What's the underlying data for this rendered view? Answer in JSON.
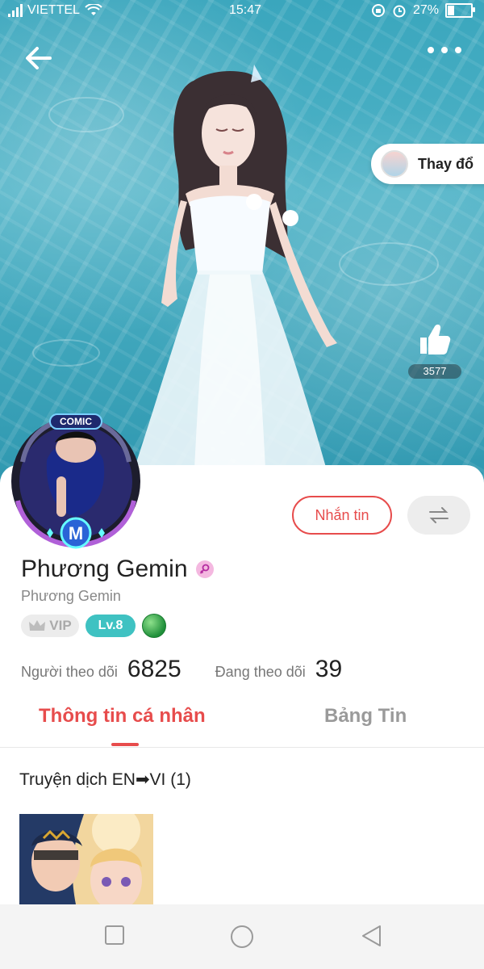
{
  "status_bar": {
    "carrier": "VIETTEL",
    "time": "15:47",
    "battery_percent": "27%"
  },
  "cover": {
    "change_button_label": "Thay đổ",
    "like_count": "3577"
  },
  "profile": {
    "display_name": "Phương Gemin",
    "username": "Phương Gemin",
    "vip_label": "VIP",
    "level_label": "Lv.8",
    "avatar_badge_text": "COMIC",
    "avatar_badge_letter": "M",
    "message_button_label": "Nhắn tin",
    "followers_label": "Người theo dõi",
    "followers_count": "6825",
    "following_label": "Đang theo dõi",
    "following_count": "39"
  },
  "tabs": [
    {
      "label": "Thông tin cá nhân",
      "active": true
    },
    {
      "label": "Bảng Tin",
      "active": false
    }
  ],
  "section": {
    "title": "Truyện dịch EN➡VI (1)"
  },
  "colors": {
    "accent": "#e74c4c",
    "level_badge": "#3fc2c2",
    "cover_water": "#3aa6bd"
  },
  "icons": [
    "back-arrow-icon",
    "more-dots-icon",
    "thumbs-up-icon",
    "swap-icon",
    "female-gender-icon",
    "crown-icon",
    "wifi-icon",
    "alarm-icon",
    "battery-icon",
    "nav-square-icon",
    "nav-circle-icon",
    "nav-back-triangle-icon"
  ]
}
